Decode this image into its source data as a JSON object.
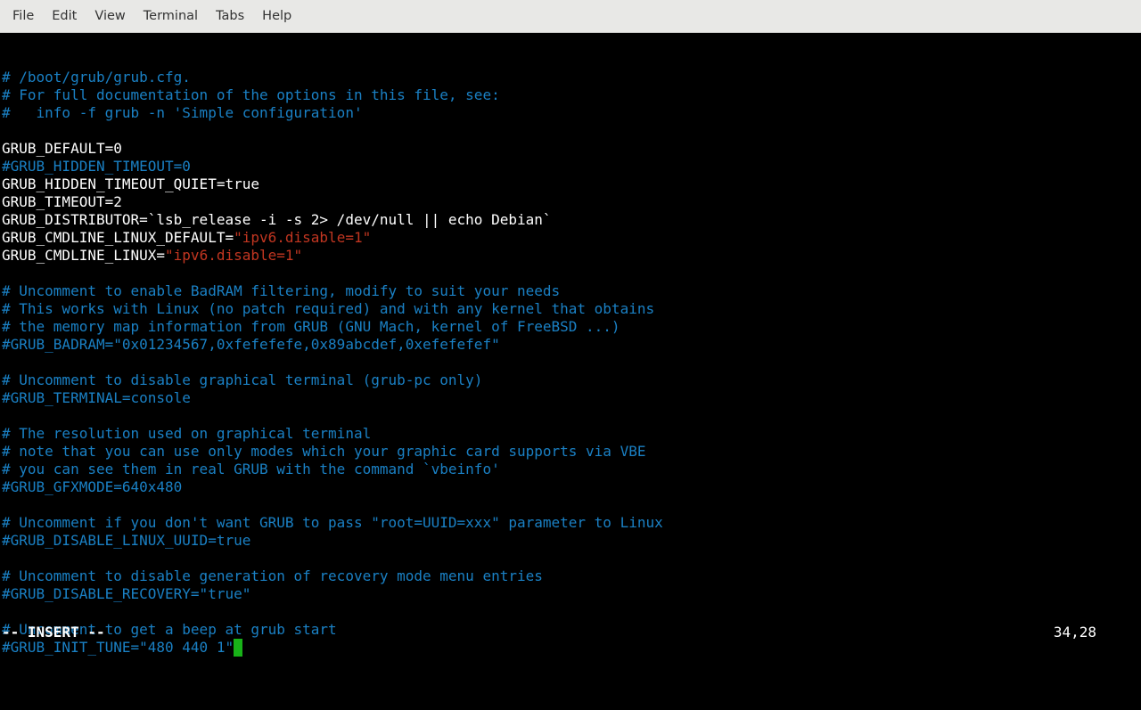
{
  "menubar": [
    "File",
    "Edit",
    "View",
    "Terminal",
    "Tabs",
    "Help"
  ],
  "lines": [
    [
      [
        "c",
        "# /boot/grub/grub.cfg."
      ]
    ],
    [
      [
        "c",
        "# For full documentation of the options in this file, see:"
      ]
    ],
    [
      [
        "c",
        "#   info -f grub -n 'Simple configuration'"
      ]
    ],
    [],
    [
      [
        "w",
        "GRUB_DEFAULT=0"
      ]
    ],
    [
      [
        "c",
        "#GRUB_HIDDEN_TIMEOUT=0"
      ]
    ],
    [
      [
        "w",
        "GRUB_HIDDEN_TIMEOUT_QUIET=true"
      ]
    ],
    [
      [
        "w",
        "GRUB_TIMEOUT=2"
      ]
    ],
    [
      [
        "w",
        "GRUB_DISTRIBUTOR=`lsb_release -i -s 2> /dev/null || echo Debian`"
      ]
    ],
    [
      [
        "w",
        "GRUB_CMDLINE_LINUX_DEFAULT="
      ],
      [
        "s",
        "\"ipv6.disable=1\""
      ]
    ],
    [
      [
        "w",
        "GRUB_CMDLINE_LINUX="
      ],
      [
        "s",
        "\"ipv6.disable=1\""
      ]
    ],
    [],
    [
      [
        "c",
        "# Uncomment to enable BadRAM filtering, modify to suit your needs"
      ]
    ],
    [
      [
        "c",
        "# This works with Linux (no patch required) and with any kernel that obtains"
      ]
    ],
    [
      [
        "c",
        "# the memory map information from GRUB (GNU Mach, kernel of FreeBSD ...)"
      ]
    ],
    [
      [
        "c",
        "#GRUB_BADRAM=\"0x01234567,0xfefefefe,0x89abcdef,0xefefefef\""
      ]
    ],
    [],
    [
      [
        "c",
        "# Uncomment to disable graphical terminal (grub-pc only)"
      ]
    ],
    [
      [
        "c",
        "#GRUB_TERMINAL=console"
      ]
    ],
    [],
    [
      [
        "c",
        "# The resolution used on graphical terminal"
      ]
    ],
    [
      [
        "c",
        "# note that you can use only modes which your graphic card supports via VBE"
      ]
    ],
    [
      [
        "c",
        "# you can see them in real GRUB with the command `vbeinfo'"
      ]
    ],
    [
      [
        "c",
        "#GRUB_GFXMODE=640x480"
      ]
    ],
    [],
    [
      [
        "c",
        "# Uncomment if you don't want GRUB to pass \"root=UUID=xxx\" parameter to Linux"
      ]
    ],
    [
      [
        "c",
        "#GRUB_DISABLE_LINUX_UUID=true"
      ]
    ],
    [],
    [
      [
        "c",
        "# Uncomment to disable generation of recovery mode menu entries"
      ]
    ],
    [
      [
        "c",
        "#GRUB_DISABLE_RECOVERY=\"true\""
      ]
    ],
    [],
    [
      [
        "c",
        "# Uncomment to get a beep at grub start"
      ]
    ],
    [
      [
        "c",
        "#GRUB_INIT_TUNE=\"480 440 1\""
      ],
      [
        "cursor",
        ""
      ]
    ]
  ],
  "status_mode": "-- INSERT --",
  "status_pos": "34,28"
}
